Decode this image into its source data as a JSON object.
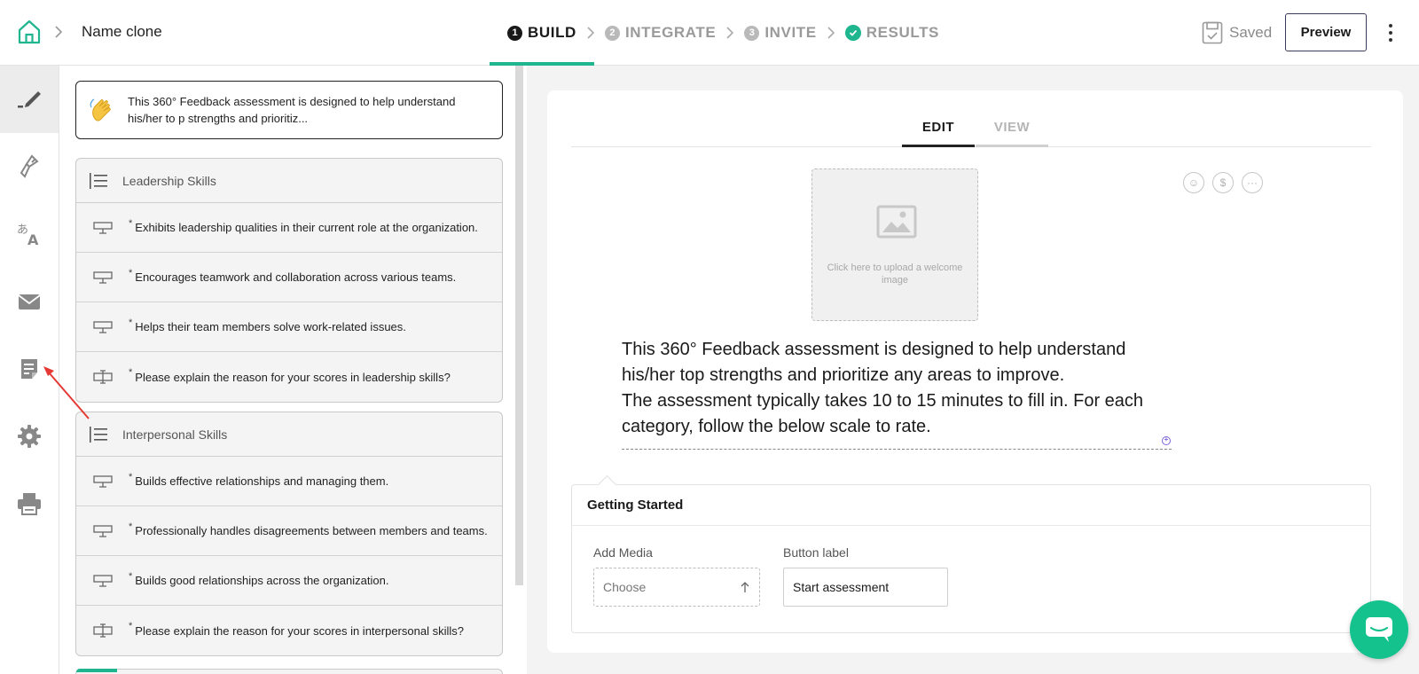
{
  "header": {
    "doc_name": "Name clone",
    "steps": [
      {
        "num": "1",
        "label": "BUILD"
      },
      {
        "num": "2",
        "label": "INTEGRATE"
      },
      {
        "num": "3",
        "label": "INVITE"
      },
      {
        "num": "",
        "label": "RESULTS"
      }
    ],
    "saved_label": "Saved",
    "preview_label": "Preview"
  },
  "rail": {
    "items": [
      "edit-pen-icon",
      "paint-brush-icon",
      "translate-icon",
      "mail-icon",
      "report-icon",
      "gear-icon",
      "print-icon"
    ]
  },
  "outline": {
    "welcome_text": "This 360° Feedback assessment is designed to help understand his/her to p strengths and prioritiz...",
    "sections": [
      {
        "title": "Leadership Skills",
        "questions": [
          {
            "type": "rating",
            "text": "Exhibits leadership qualities in their current role at the organization."
          },
          {
            "type": "rating",
            "text": "Encourages teamwork and collaboration across various teams."
          },
          {
            "type": "rating",
            "text": "Helps their team members solve work-related issues."
          },
          {
            "type": "text",
            "text": "Please explain the reason for your scores in leadership skills?"
          }
        ]
      },
      {
        "title": "Interpersonal Skills",
        "questions": [
          {
            "type": "rating",
            "text": "Builds effective relationships and managing them."
          },
          {
            "type": "rating",
            "text": "Professionally handles disagreements between members and teams."
          },
          {
            "type": "rating",
            "text": "Builds good relationships across the organization."
          },
          {
            "type": "text",
            "text": "Please explain the reason for your scores in interpersonal skills?"
          }
        ]
      }
    ],
    "required_marker": "*"
  },
  "editor": {
    "tabs": [
      "EDIT",
      "VIEW"
    ],
    "active_tab": "EDIT",
    "upload_text": "Click here to upload a welcome image",
    "emoji_tools": [
      "☺",
      "$",
      "···"
    ],
    "welcome_lines": [
      "This 360° Feedback assessment is designed to help understand his/her top strengths and prioritize any areas to improve.",
      "The assessment typically takes 10 to 15 minutes to fill in. For each category, follow the below scale to rate."
    ],
    "getting_started": {
      "title": "Getting Started",
      "add_media_label": "Add Media",
      "add_media_value": "Choose",
      "button_label_label": "Button label",
      "button_label_value": "Start assessment"
    }
  },
  "colors": {
    "accent_green": "#1fb58f",
    "chat_green": "#14c28d",
    "annotation_red": "#e53935"
  }
}
